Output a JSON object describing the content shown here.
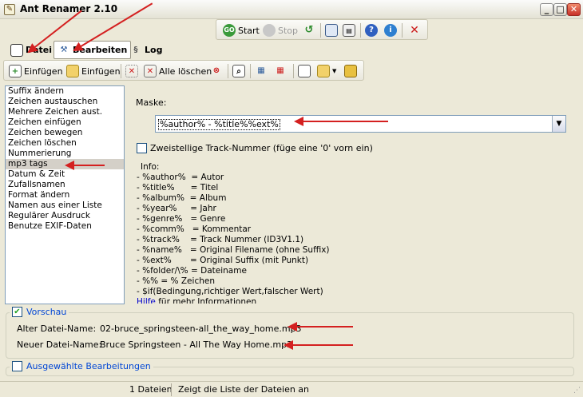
{
  "window": {
    "title": "Ant Renamer 2.10",
    "min": "_",
    "max": "□",
    "close": "✕"
  },
  "toolbar_main": {
    "start": "Start",
    "stop": "Stop"
  },
  "tabs": [
    {
      "label": "Datei"
    },
    {
      "label": "Bearbeiten"
    },
    {
      "label": "Log"
    }
  ],
  "toolbar_files": {
    "add_files": "Einfügen",
    "add_folder": "Einfügen",
    "delete_all": "Alle löschen"
  },
  "actions": [
    "Suffix ändern",
    "Zeichen austauschen",
    "Mehrere Zeichen aust.",
    "Zeichen einfügen",
    "Zeichen bewegen",
    "Zeichen löschen",
    "Nummerierung",
    "mp3 tags",
    "Datum & Zeit",
    "Zufallsnamen",
    "Format ändern",
    "Namen aus einer Liste",
    "Regulärer Ausdruck",
    "Benutze EXIF-Daten"
  ],
  "selected_action": "mp3 tags",
  "form": {
    "mask_label": "Maske:",
    "mask_value": "%author% - %title%%ext%",
    "two_digit_label": "Zweistellige Track-Nummer (füge eine '0' vorn ein)",
    "info_title": "Info:",
    "info_lines": [
      "- %author%  = Autor",
      "- %title%      = Titel",
      "- %album%  = Album",
      "- %year%     = Jahr",
      "- %genre%   = Genre",
      "- %comm%   = Kommentar",
      "- %track%    = Track Nummer (ID3V1.1)",
      "- %name%   = Original Filename (ohne Suffix)",
      "- %ext%       = Original Suffix (mit Punkt)",
      "- %folder/\\% = Dateiname",
      "- %% = % Zeichen",
      "- $if(Bedingung,richtiger Wert,falscher Wert)"
    ],
    "help_link": "Hilfe",
    "help_rest": " für mehr Informationen"
  },
  "preview": {
    "label": "Vorschau",
    "old_label": "Alter Datei-Name:",
    "old_value": "02-bruce_springsteen-all_the_way_home.mp3",
    "new_label": "Neuer Datei-Name:",
    "new_value": "Bruce Springsteen - All The Way Home.mp3"
  },
  "batch": {
    "label": "Ausgewählte Bearbeitungen"
  },
  "status": {
    "count": "1 Dateien",
    "hint": "Zeigt die Liste der Dateien an"
  },
  "colors": {
    "arrow": "#d42020",
    "link": "#0046d5",
    "checkmark": "#21a121"
  }
}
